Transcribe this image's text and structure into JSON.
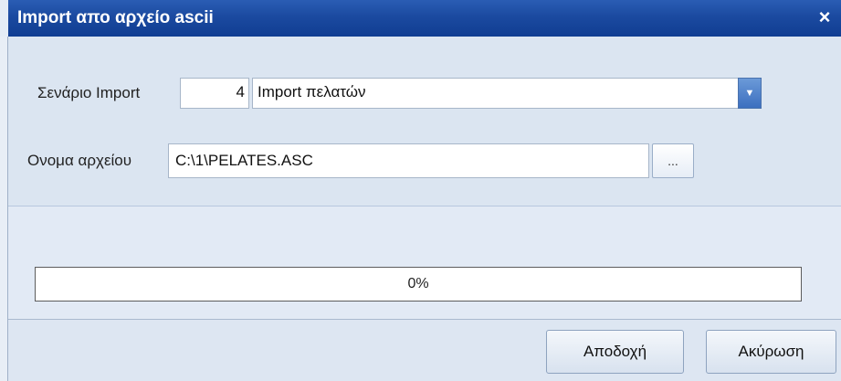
{
  "window": {
    "title": "Import απο αρχείο ascii",
    "close_glyph": "×"
  },
  "form": {
    "scenario_label": "Σενάριο Import",
    "scenario_number": "4",
    "scenario_name": "Import πελατών",
    "filename_label": "Ονομα αρχείου",
    "filename_value": "C:\\1\\PELATES.ASC",
    "browse_label": "..."
  },
  "progress": {
    "value": 0,
    "text": "0%"
  },
  "buttons": {
    "accept_label": "Αποδοχή",
    "cancel_label": "Ακύρωση"
  },
  "icons": {
    "dropdown": "chevron-down-icon",
    "close": "close-icon"
  },
  "colors": {
    "titlebar": "#1b4aa0",
    "panel": "#dbe5f1",
    "combo_button": "#3c6fbf"
  }
}
